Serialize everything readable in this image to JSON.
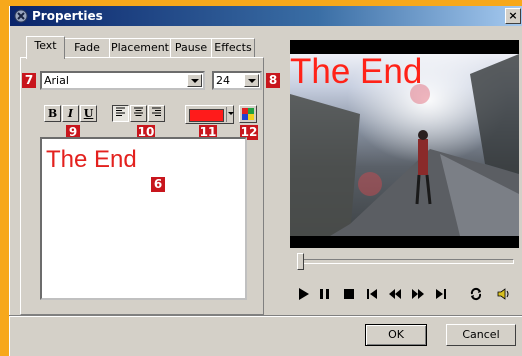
{
  "window": {
    "title": "Properties",
    "close_label": "×"
  },
  "tabs": [
    {
      "label": "Text",
      "active": true
    },
    {
      "label": "Fade"
    },
    {
      "label": "Placement"
    },
    {
      "label": "Pause"
    },
    {
      "label": "Effects"
    }
  ],
  "font": {
    "family": "Arial",
    "size": "24"
  },
  "format_buttons": {
    "bold": "B",
    "italic": "I",
    "underline": "U"
  },
  "text_color": "#ff1b1b",
  "editor": {
    "text": "The End"
  },
  "preview": {
    "overlay_text": "The End"
  },
  "badges": [
    "7",
    "8",
    "9",
    "10",
    "11",
    "12",
    "6"
  ],
  "seek_position": 0,
  "buttons": {
    "ok": "OK",
    "cancel": "Cancel"
  }
}
